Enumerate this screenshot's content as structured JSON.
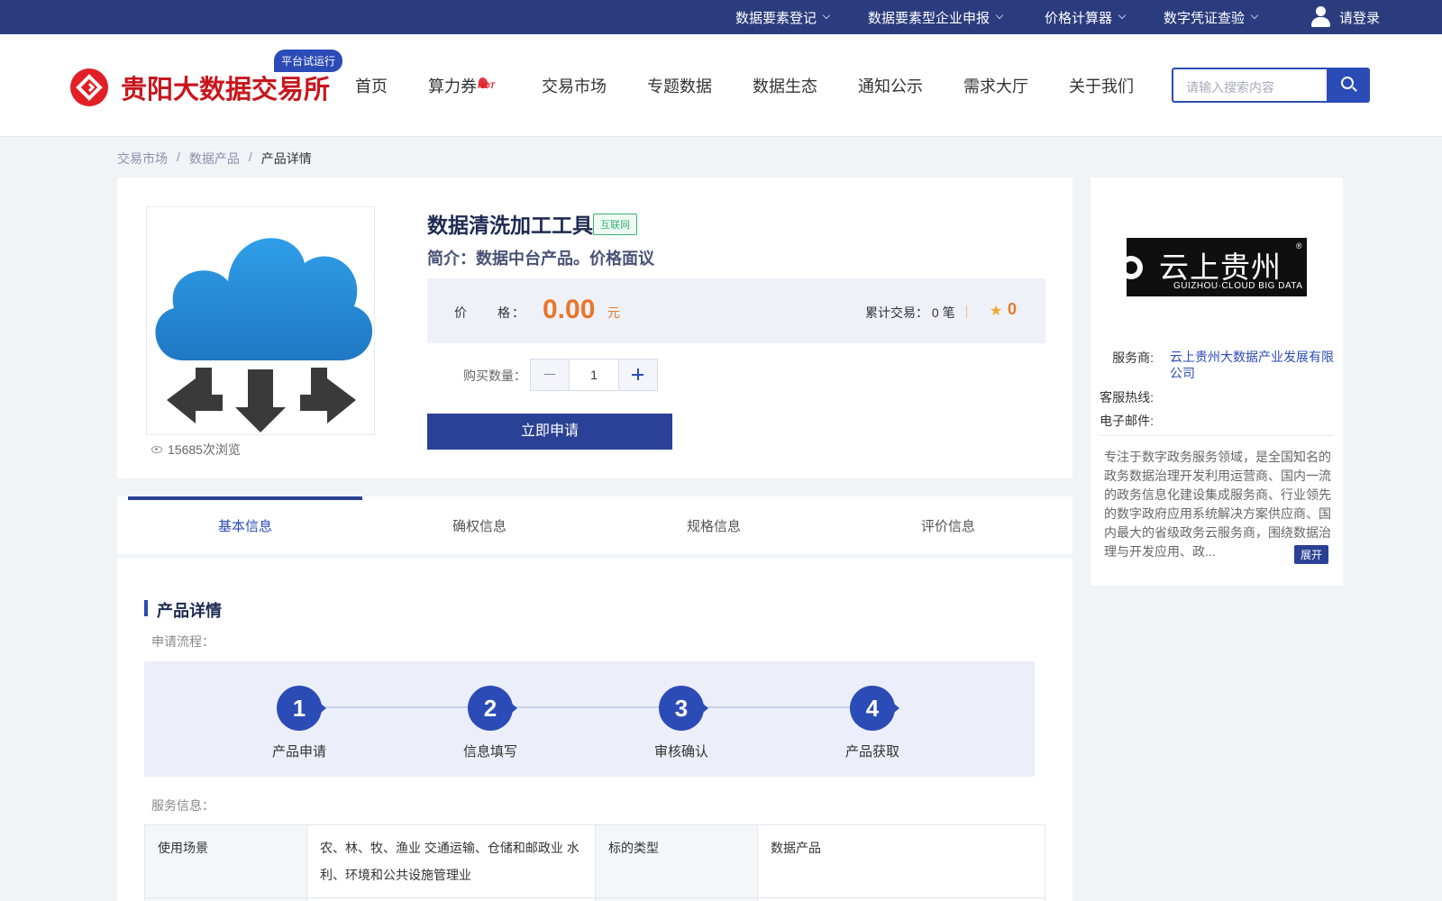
{
  "topbar": {
    "items": [
      "数据要素登记",
      "数据要素型企业申报",
      "价格计算器",
      "数字凭证查验"
    ],
    "login": "请登录"
  },
  "header": {
    "brand": "贵阳大数据交易所",
    "trial_badge": "平台试运行",
    "nav": [
      "首页",
      "算力券",
      "交易市场",
      "专题数据",
      "数据生态",
      "通知公示",
      "需求大厅",
      "关于我们"
    ],
    "hot_label": "HOT",
    "search_placeholder": "请输入搜索内容"
  },
  "breadcrumb": [
    "交易市场",
    "数据产品",
    "产品详情"
  ],
  "breadcrumb_sep": "/",
  "product": {
    "views": "15685次浏览",
    "title": "数据清洗加工工具",
    "tag": "互联网",
    "intro": "简介：数据中台产品。价格面议",
    "price_label": "价　　格：",
    "price": "0.00",
    "price_unit": "元",
    "trades": "累计交易： 0 笔",
    "rating": "0",
    "qty_label": "购买数量：",
    "qty": "1",
    "apply": "立即申请"
  },
  "provider": {
    "logo_cn": "云上贵州",
    "logo_en": "GUIZHOU·CLOUD BIG DATA",
    "logo_reg": "®",
    "k_service": "服务商:",
    "v_service": "云上贵州大数据产业发展有限公司",
    "k_hotline": "客服热线:",
    "k_email": "电子邮件:",
    "desc": "专注于数字政务服务领域，是全国知名的政务数据治理开发利用运营商、国内一流的政务信息化建设集成服务商、行业领先的数字政府应用系统解决方案供应商、国内最大的省级政务云服务商，围绕数据治理与开发应用、政...",
    "expand": "展开"
  },
  "tabs": [
    "基本信息",
    "确权信息",
    "规格信息",
    "评价信息"
  ],
  "detail": {
    "title": "产品详情",
    "flow_label": "申请流程：",
    "steps": [
      {
        "num": "1",
        "label": "产品申请"
      },
      {
        "num": "2",
        "label": "信息填写"
      },
      {
        "num": "3",
        "label": "审核确认"
      },
      {
        "num": "4",
        "label": "产品获取"
      }
    ],
    "service_label": "服务信息：",
    "table": {
      "k1": "使用场景",
      "v1": "农、林、牧、渔业 交通运输、仓储和邮政业 水利、环境和公共设施管理业",
      "k2": "标的类型",
      "v2": "数据产品"
    }
  },
  "colors": {
    "primary": "#2b4bb6",
    "topbar": "#2b3c7e",
    "brand_red": "#c8161d",
    "price": "#e8762b"
  }
}
